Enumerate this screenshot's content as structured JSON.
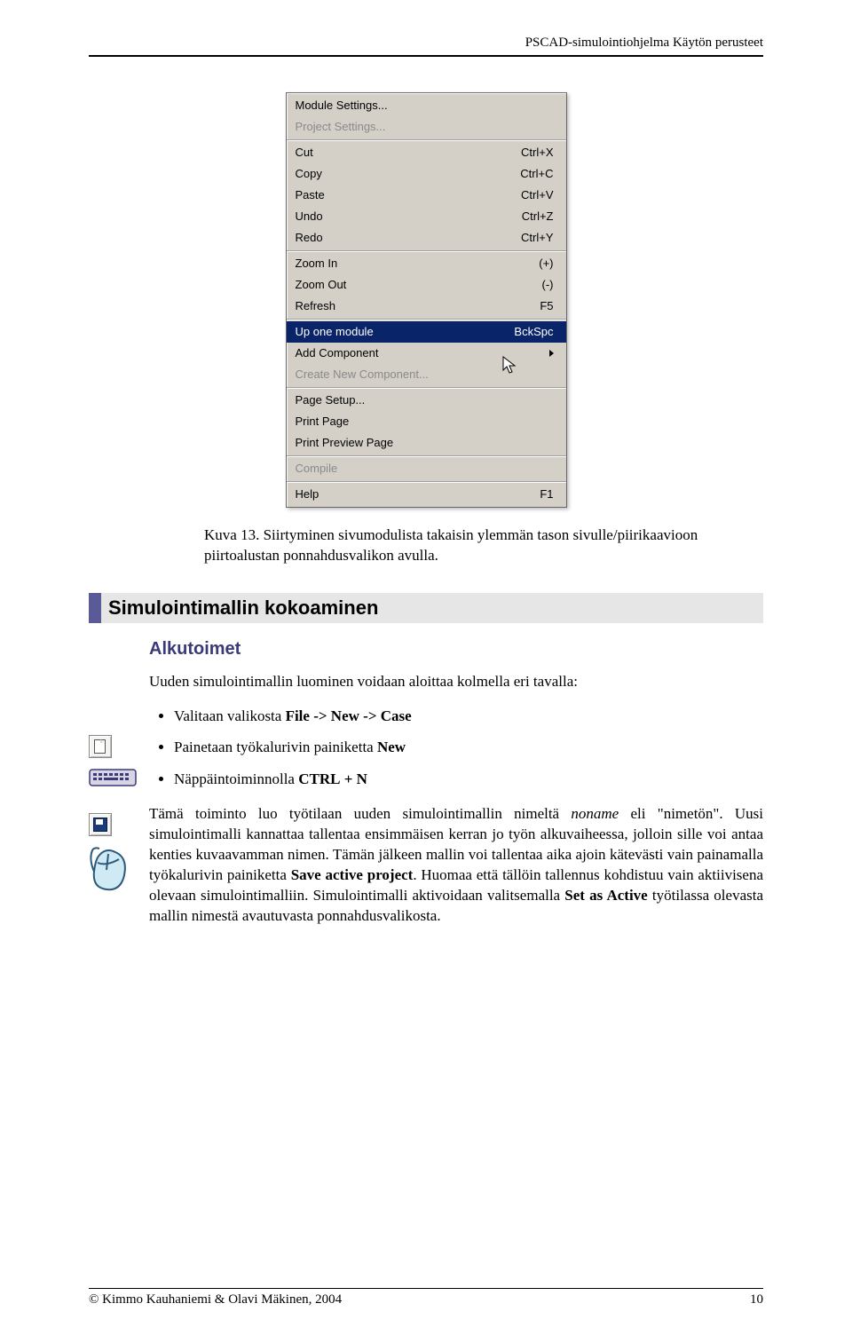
{
  "header": {
    "doc_title": "PSCAD-simulointiohjelma Käytön perusteet"
  },
  "menu": {
    "groups": [
      {
        "items": [
          {
            "label": "Module Settings...",
            "shortcut": "",
            "disabled": false
          },
          {
            "label": "Project Settings...",
            "shortcut": "",
            "disabled": true
          }
        ]
      },
      {
        "items": [
          {
            "label": "Cut",
            "shortcut": "Ctrl+X"
          },
          {
            "label": "Copy",
            "shortcut": "Ctrl+C"
          },
          {
            "label": "Paste",
            "shortcut": "Ctrl+V"
          },
          {
            "label": "Undo",
            "shortcut": "Ctrl+Z"
          },
          {
            "label": "Redo",
            "shortcut": "Ctrl+Y"
          }
        ]
      },
      {
        "items": [
          {
            "label": "Zoom In",
            "shortcut": "(+)"
          },
          {
            "label": "Zoom Out",
            "shortcut": "(-)"
          },
          {
            "label": "Refresh",
            "shortcut": "F5"
          }
        ]
      },
      {
        "items": [
          {
            "label": "Up one module",
            "shortcut": "BckSpc",
            "highlight": true
          },
          {
            "label": "Add Component",
            "shortcut": "",
            "submenu": true,
            "cursor": true
          },
          {
            "label": "Create New Component...",
            "shortcut": "",
            "disabled": true
          }
        ]
      },
      {
        "items": [
          {
            "label": "Page Setup...",
            "shortcut": ""
          },
          {
            "label": "Print Page",
            "shortcut": ""
          },
          {
            "label": "Print Preview Page",
            "shortcut": ""
          }
        ]
      },
      {
        "items": [
          {
            "label": "Compile",
            "shortcut": "",
            "disabled": true
          }
        ]
      },
      {
        "items": [
          {
            "label": "Help",
            "shortcut": "F1"
          }
        ]
      }
    ]
  },
  "caption": {
    "text": "Kuva 13. Siirtyminen sivumodulista takaisin ylemmän tason sivulle/piirikaavioon piirtoalustan ponnahdusvalikon avulla."
  },
  "section": {
    "title": "Simulointimallin kokoaminen",
    "sub": "Alkutoimet",
    "intro": "Uuden simulointimallin luominen voidaan aloittaa kolmella eri tavalla:",
    "bullets": [
      {
        "pre": "Valitaan valikosta ",
        "bold": "File -> New -> Case",
        "post": ""
      },
      {
        "pre": "Painetaan työkalurivin painiketta ",
        "bold": "New",
        "post": ""
      },
      {
        "pre": "Näppäintoiminnolla ",
        "sc": "CTRL",
        "scpost": " + N"
      }
    ],
    "para": "Tämä toiminto luo työtilaan uuden simulointimallin nimeltä noname eli \"nimetön\". Uusi simulointimalli kannattaa tallentaa ensimmäisen kerran jo työn alkuvaiheessa, jolloin sille voi antaa kenties kuvaavamman nimen. Tämän jälkeen mallin voi tallentaa aika ajoin kätevästi vain painamalla työkalurivin painiketta Save active project. Huomaa että tällöin tallennus kohdistuu vain aktiivisena olevaan simulointimalliin. Simulointimalli aktivoidaan valitsemalla Set as Active työtilassa olevasta mallin nimestä avautuvasta ponnahdusvalikosta.",
    "para_parts": {
      "p1": "Tämä toiminto luo työtilaan uuden simulointimallin nimeltä ",
      "i1": "noname",
      "p2": " eli \"nimetön\". Uusi simulointimalli kannattaa tallentaa ensimmäisen kerran jo työn alkuvaiheessa, jolloin sille voi antaa kenties kuvaavamman nimen. Tämän jälkeen mallin voi tallentaa aika ajoin kätevästi vain painamalla työkalurivin painiketta ",
      "b1": "Save active project",
      "p3": ". Huomaa että tällöin tallennus kohdistuu vain aktiivisena olevaan simulointimalliin. Simulointimalli aktivoidaan valitsemalla ",
      "b2": "Set as Active",
      "p4": " työtilassa olevasta mallin nimestä avautuvasta ponnahdusvalikosta."
    }
  },
  "footer": {
    "left": "© Kimmo Kauhaniemi & Olavi Mäkinen, 2004",
    "right": "10"
  }
}
